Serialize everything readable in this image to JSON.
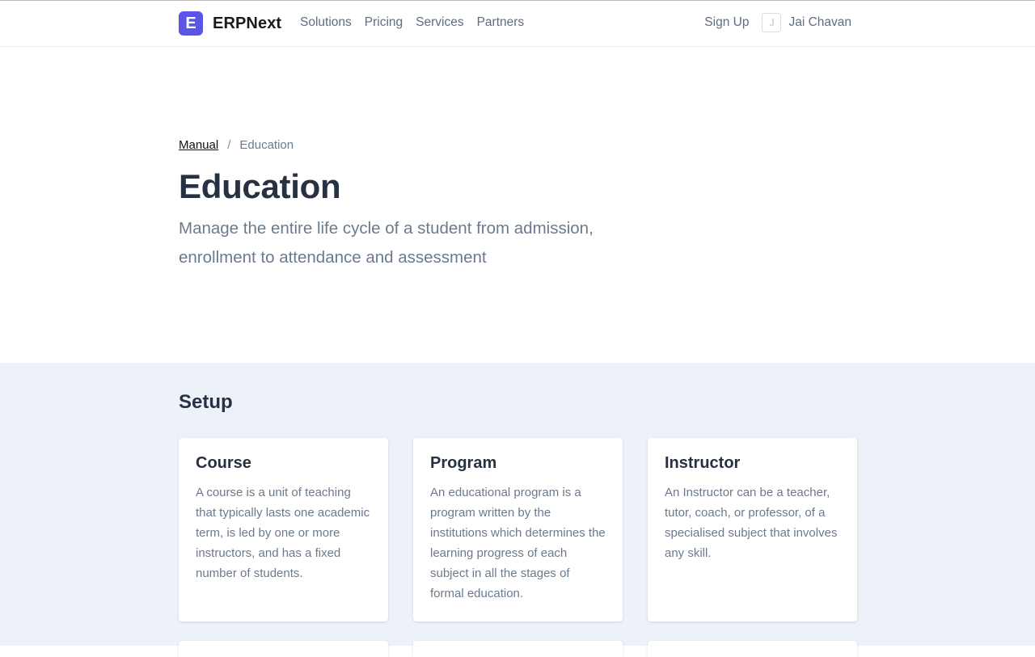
{
  "navbar": {
    "logo_letter": "E",
    "brand": "ERPNext",
    "links": [
      "Solutions",
      "Pricing",
      "Services",
      "Partners"
    ],
    "signup": "Sign Up",
    "avatar_initial": "J",
    "user_name": "Jai Chavan"
  },
  "breadcrumb": {
    "root": "Manual",
    "separator": "/",
    "current": "Education"
  },
  "hero": {
    "title": "Education",
    "subtitle": "Manage the entire life cycle of a student from admission, enrollment to attendance and assessment"
  },
  "setup": {
    "title": "Setup",
    "cards": [
      {
        "title": "Course",
        "description": "A course is a unit of teaching that typically lasts one academic term, is led by one or more instructors, and has a fixed number of students."
      },
      {
        "title": "Program",
        "description": "An educational program is a program written by the institutions which determines the learning progress of each subject in all the stages of formal education."
      },
      {
        "title": "Instructor",
        "description": "An Instructor can be a teacher, tutor, coach, or professor, of a specialised subject that involves any skill."
      }
    ]
  },
  "colors": {
    "brand": "#5a55e6",
    "section_bg": "#edf2f8",
    "heading": "#283142",
    "muted": "#6b7a8d"
  }
}
